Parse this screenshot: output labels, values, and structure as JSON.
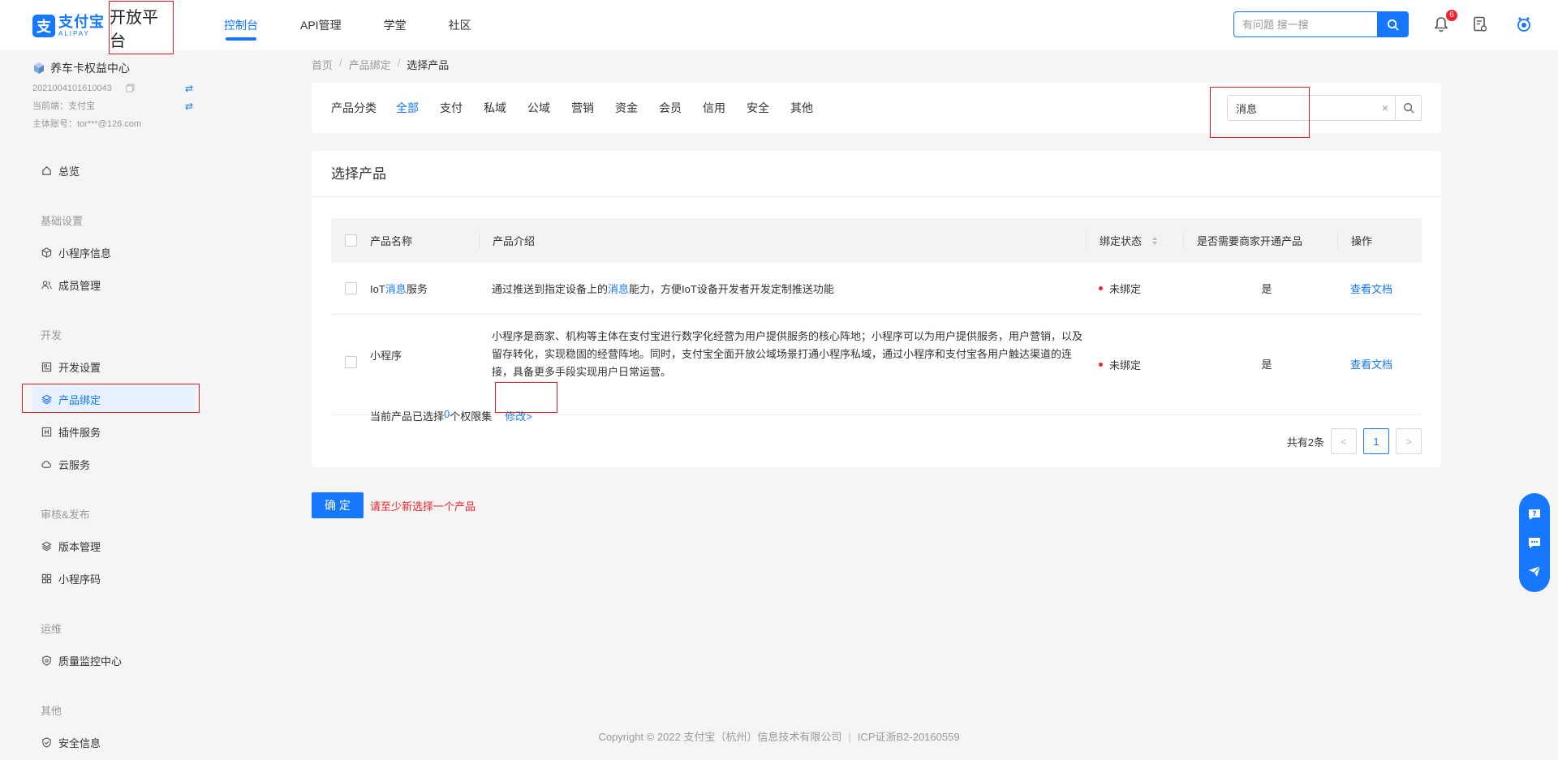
{
  "header": {
    "logo_cn": "支付宝",
    "logo_en": "ALIPAY",
    "logo_mark": "支",
    "platform": "开放平台",
    "nav": [
      {
        "label": "控制台",
        "active": true
      },
      {
        "label": "API管理",
        "active": false
      },
      {
        "label": "学堂",
        "active": false
      },
      {
        "label": "社区",
        "active": false
      }
    ],
    "search_placeholder": "有问题 搜一搜",
    "notification_count": "6",
    "icons": [
      "search-icon",
      "bell-icon",
      "document-icon",
      "avatar-icon"
    ]
  },
  "sidebar": {
    "app_name": "养车卡权益中心",
    "app_id": "2021004101610043",
    "current_end": "当前端：支付宝",
    "account": "主体账号：tor***@126.com",
    "groups": {
      "basic": "基础设置",
      "dev": "开发",
      "review": "审核&发布",
      "ops": "运维",
      "other": "其他"
    },
    "items": {
      "overview": "总览",
      "miniapp_info": "小程序信息",
      "members": "成员管理",
      "dev_settings": "开发设置",
      "product_binding": "产品绑定",
      "plugin": "插件服务",
      "cloud": "云服务",
      "version": "版本管理",
      "qrcode": "小程序码",
      "quality": "质量监控中心",
      "security": "安全信息"
    }
  },
  "breadcrumb": {
    "home": "首页",
    "parent": "产品绑定",
    "current": "选择产品",
    "sep": "/"
  },
  "filter": {
    "label": "产品分类",
    "categories": [
      "全部",
      "支付",
      "私域",
      "公域",
      "营销",
      "资金",
      "会员",
      "信用",
      "安全",
      "其他"
    ],
    "active_category": "全部",
    "search_value": "消息",
    "clear": "×"
  },
  "products": {
    "title": "选择产品",
    "columns": {
      "name": "产品名称",
      "intro": "产品介绍",
      "status": "绑定状态",
      "need": "是否需要商家开通产品",
      "op": "操作"
    },
    "rows": [
      {
        "name_pre": "IoT",
        "name_hl": "消息",
        "name_post": "服务",
        "intro_pre": "通过推送到指定设备上的",
        "intro_hl": "消息",
        "intro_post": "能力，方便IoT设备开发者开发定制推送功能",
        "status": "未绑定",
        "need": "是",
        "op": "查看文档"
      },
      {
        "name": "小程序",
        "intro": "小程序是商家、机构等主体在支付宝进行数字化经营为用户提供服务的核心阵地；小程序可以为用户提供服务，用户营销，以及留存转化，实现稳固的经营阵地。同时，支付宝全面开放公域场景打通小程序私域，通过小程序和支付宝各用户触达渠道的连接，具备更多手段实现用户日常运营。",
        "status": "未绑定",
        "need": "是",
        "op": "查看文档",
        "perm_pre": "当前产品已选择",
        "perm_count": "0",
        "perm_post": "个权限集",
        "modify": "修改>"
      }
    ],
    "total": "共有2条",
    "current_page": "1",
    "prev": "<",
    "next": ">"
  },
  "actions": {
    "confirm": "确 定",
    "warning": "请至少新选择一个产品"
  },
  "footer": {
    "copyright": "Copyright © 2022 支付宝（杭州）信息技术有限公司",
    "bar": "|",
    "icp": "ICP证浙B2-20160559"
  },
  "colors": {
    "primary": "#1677ff",
    "danger": "#f5222d",
    "highlight_box": "#e01b24"
  }
}
